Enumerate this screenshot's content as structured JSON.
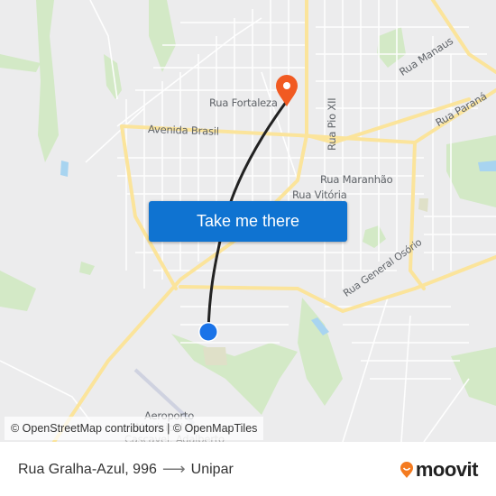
{
  "map": {
    "street_labels": [
      {
        "text": "Rua Fortaleza"
      },
      {
        "text": "Avenida Brasil"
      },
      {
        "text": "Rua Pio XII"
      },
      {
        "text": "Rua Manaus"
      },
      {
        "text": "Rua Paraná"
      },
      {
        "text": "Rua Maranhão"
      },
      {
        "text": "Rua Vitória"
      },
      {
        "text": "Rua General Osório"
      },
      {
        "text": "Aeroporto"
      },
      {
        "text": "Municipal de"
      },
      {
        "text": "Cascavel, Adalberto"
      }
    ],
    "colors": {
      "background": "#ececed",
      "major_road": "#fbe49b",
      "minor_road": "#ffffff",
      "park": "#cfe8c2",
      "water": "#a8d4f0",
      "route_line": "#222222",
      "origin_dot": "#1a73e8",
      "destination_pin": "#f15a22"
    }
  },
  "cta": {
    "label": "Take me there",
    "color": "#0f73d1"
  },
  "attribution": {
    "text": "© OpenStreetMap contributors | © OpenMapTiles"
  },
  "footer": {
    "origin": "Rua Gralha-Azul, 996",
    "arrow": "⟶",
    "destination": "Unipar",
    "logo_text": "moovit",
    "logo_color": "#f47b20"
  }
}
